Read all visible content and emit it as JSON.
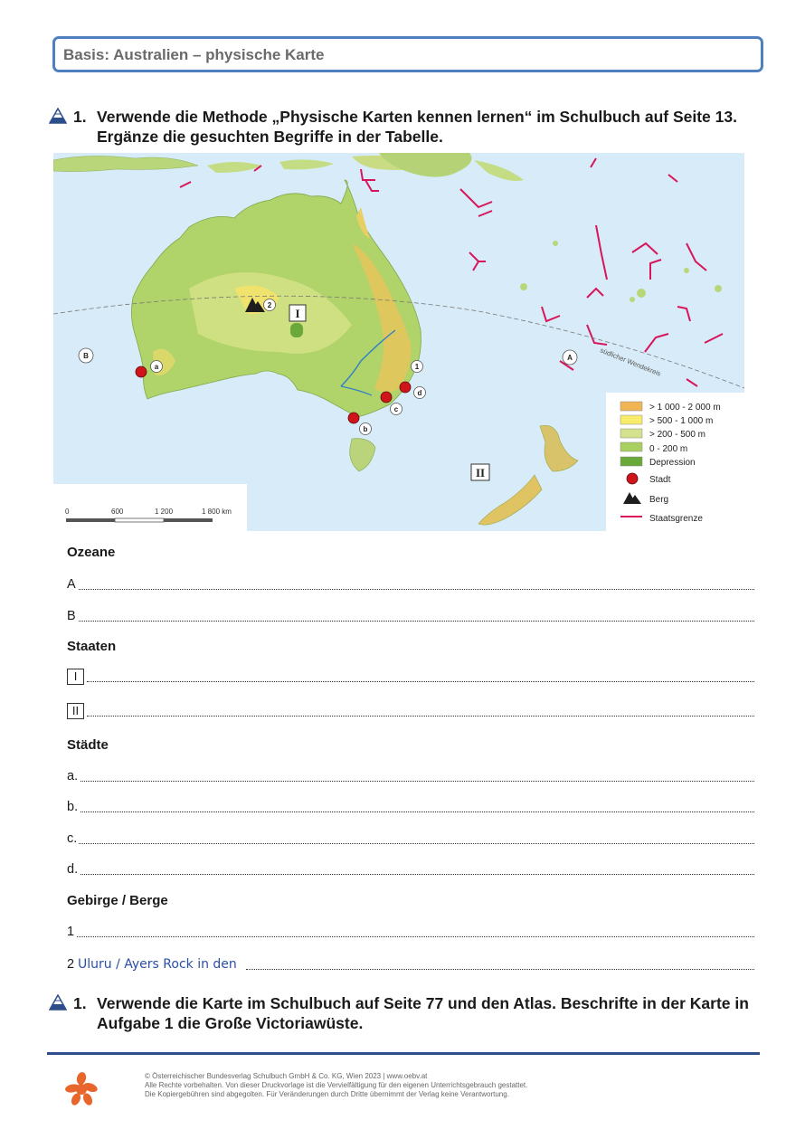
{
  "header": {
    "title": "Basis: Australien – physische Karte"
  },
  "task1": {
    "number": "1.",
    "text": "Verwende die Methode „Physische Karten kennen lernen“ im Schulbuch auf Seite 13. Ergänze die gesuchten Begriffe in der Tabelle."
  },
  "map": {
    "markers": {
      "A": "A",
      "B": "B",
      "I": "I",
      "II": "II",
      "a": "a",
      "b": "b",
      "c": "c",
      "d": "d",
      "one": "1",
      "two": "2"
    },
    "tropic_label": "südlicher Wendekreis",
    "scale": {
      "labels": [
        "0",
        "600",
        "1 200",
        "1 800 km"
      ]
    },
    "legend": {
      "items": [
        {
          "label": "> 1 000 - 2 000 m",
          "color": "#f0b455"
        },
        {
          "label": "> 500 - 1 000 m",
          "color": "#f8ec6a"
        },
        {
          "label": "> 200 - 500 m",
          "color": "#d4e28e"
        },
        {
          "label": "0 - 200 m",
          "color": "#a9cf5f"
        },
        {
          "label": "Depression",
          "color": "#6aa83a"
        },
        {
          "label": "Stadt",
          "symbol": "red-dot"
        },
        {
          "label": "Berg",
          "symbol": "mountain"
        },
        {
          "label": "Staatsgrenze",
          "symbol": "red-line"
        }
      ]
    },
    "colors": {
      "ocean": "#d7ecf8",
      "border": "#d8155a",
      "city": "#d0141b"
    }
  },
  "sections": {
    "oceans": {
      "heading": "Ozeane",
      "lines": [
        "A",
        "B"
      ]
    },
    "states": {
      "heading": "Staaten",
      "lines": [
        "I",
        "II"
      ]
    },
    "cities": {
      "heading": "Städte",
      "lines": [
        "a.",
        "b.",
        "c.",
        "d."
      ]
    },
    "mountains": {
      "heading": "Gebirge / Berge",
      "lines": [
        "1",
        "2"
      ],
      "answer2": "Uluru / Ayers Rock in den"
    }
  },
  "task2": {
    "number": "1.",
    "text": "Verwende die Karte im Schulbuch auf Seite 77 und den Atlas. Beschrifte in der Karte in Aufgabe 1 die Große Victoriawüste."
  },
  "footer": {
    "lines": [
      "© Österreichischer Bundesverlag Schulbuch GmbH & Co. KG, Wien 2023 | www.oebv.at",
      "Alle Rechte vorbehalten. Von dieser Druckvorlage ist die Vervielfältigung für den eigenen Unterrichtsgebrauch gestattet.",
      "Die Kopiergebühren sind abgegolten. Für Veränderungen durch Dritte übernimmt der Verlag keine Verantwortung."
    ],
    "logo_color": "#e8652b"
  }
}
